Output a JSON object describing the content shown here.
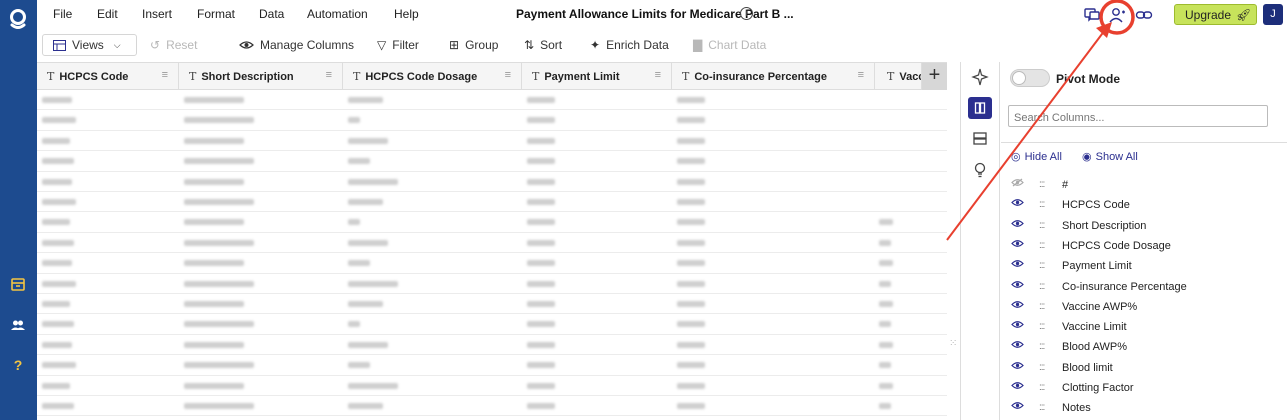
{
  "menu": [
    "File",
    "Edit",
    "Insert",
    "Format",
    "Data",
    "Automation",
    "Help"
  ],
  "doc_title": "Payment Allowance Limits for Medicare Part B ...",
  "info_glyph": "i",
  "upgrade_label": "Upgrade",
  "user_initial": "J",
  "toolbar": {
    "views": "Views",
    "reset": "Reset",
    "manage_columns": "Manage Columns",
    "filter": "Filter",
    "group": "Group",
    "sort": "Sort",
    "enrich": "Enrich Data",
    "chart": "Chart Data"
  },
  "grid": {
    "headers": [
      "HCPCS Code",
      "Short Description",
      "HCPCS Code Dosage",
      "Payment Limit",
      "Co-insurance Percentage",
      "Vacc"
    ],
    "add_glyph": "+",
    "row_count": 17
  },
  "panel": {
    "pivot_label": "Pivot Mode",
    "search_placeholder": "Search Columns...",
    "hide_all": "Hide All",
    "show_all": "Show All",
    "columns": [
      "#",
      "HCPCS Code",
      "Short Description",
      "HCPCS Code Dosage",
      "Payment Limit",
      "Co-insurance Percentage",
      "Vaccine AWP%",
      "Vaccine Limit",
      "Blood AWP%",
      "Blood limit",
      "Clotting Factor",
      "Notes"
    ]
  },
  "colors": {
    "rail": "#1d4b8f",
    "accent": "#2b2f8f",
    "upgrade": "#c7e35b",
    "annotation": "#e8402f"
  }
}
